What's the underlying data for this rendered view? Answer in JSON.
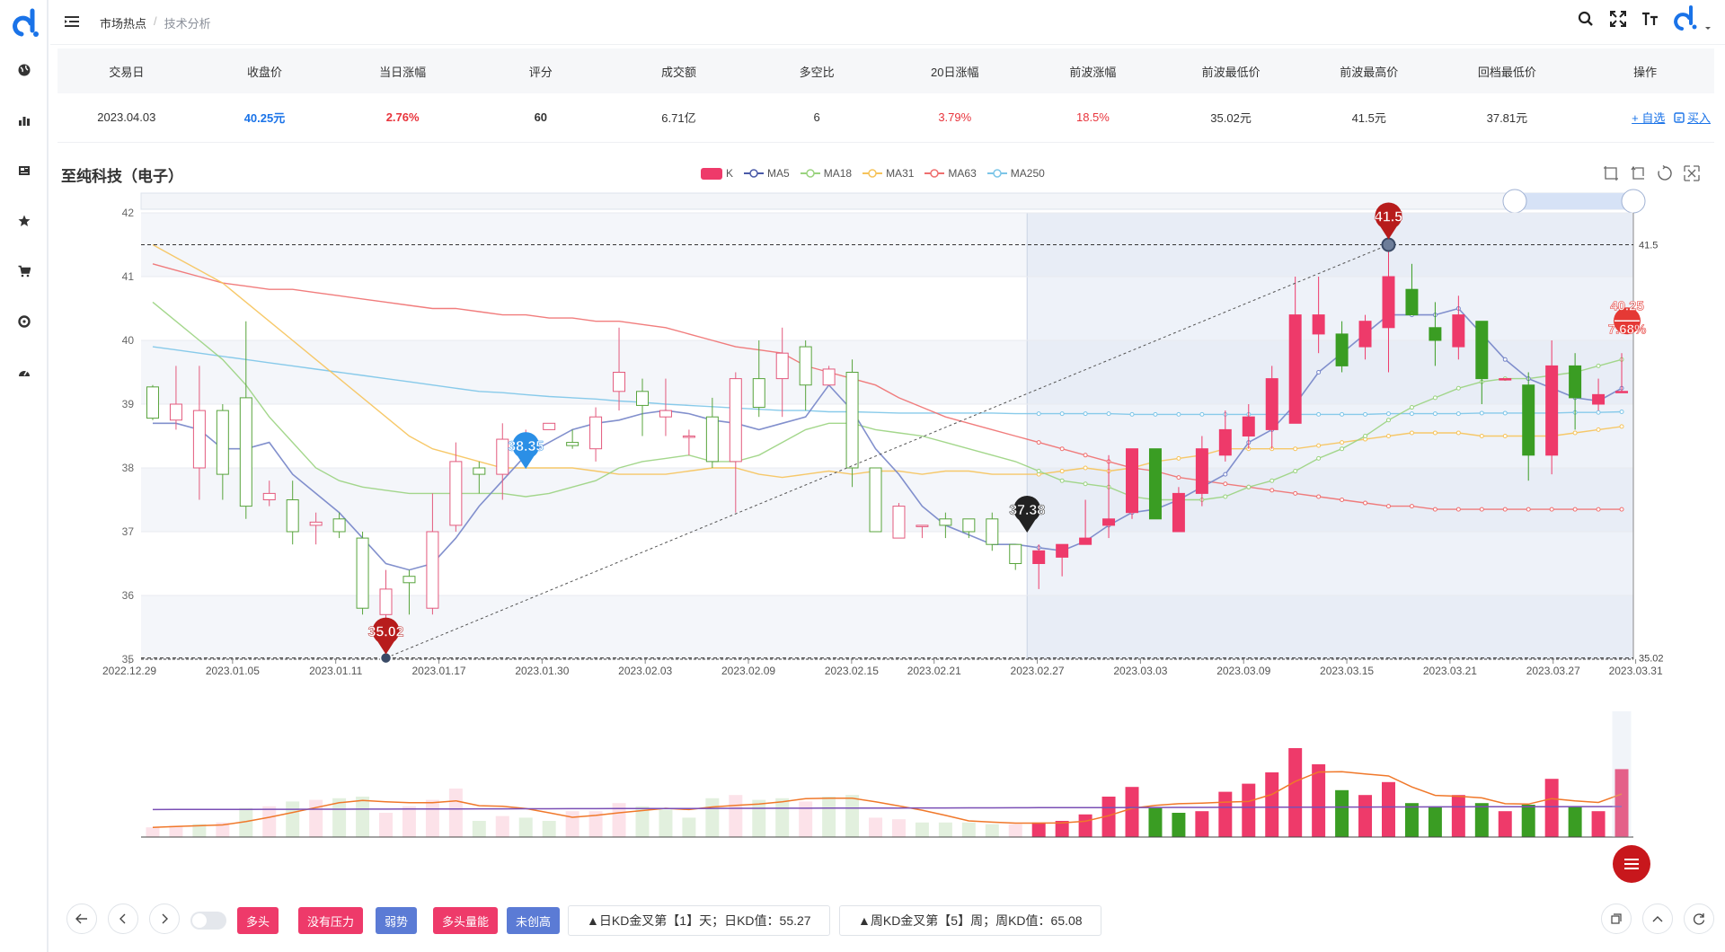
{
  "app": {
    "logo_text": "d",
    "accent": "#1a73e8"
  },
  "sidebar": {
    "items": [
      {
        "icon": "globe-icon"
      },
      {
        "icon": "bar-chart-icon"
      },
      {
        "icon": "newspaper-icon"
      },
      {
        "icon": "star-icon"
      },
      {
        "icon": "cart-icon"
      },
      {
        "icon": "target-icon"
      },
      {
        "icon": "dashboard-icon"
      }
    ]
  },
  "breadcrumb": {
    "parent": "市场热点",
    "separator": "/",
    "current": "技术分析"
  },
  "toolbar": {
    "icons": [
      "search-icon",
      "fullscreen-icon",
      "font-size-icon",
      "user-avatar-icon"
    ]
  },
  "summary": {
    "headers": [
      "交易日",
      "收盘价",
      "当日涨幅",
      "评分",
      "成交额",
      "多空比",
      "20日涨幅",
      "前波涨幅",
      "前波最低价",
      "前波最高价",
      "回档最低价",
      "操作"
    ],
    "row": {
      "date": "2023.04.03",
      "close": "40.25元",
      "change": "2.76%",
      "score": "60",
      "amount": "6.71亿",
      "ratio": "6",
      "change20": "3.79%",
      "wave_change": "18.5%",
      "wave_low": "35.02元",
      "wave_high": "41.5元",
      "pullback_low": "37.81元",
      "op_watch": "+ 自选",
      "op_buy": "买入"
    }
  },
  "chart": {
    "title": "至纯科技（电子）"
  },
  "chart_data": {
    "type": "candlestick",
    "ylim": [
      35,
      42
    ],
    "yticks": [
      "42",
      "41",
      "40",
      "39",
      "38",
      "37",
      "36",
      "35"
    ],
    "xticks": [
      "2022.12.29",
      "2023.01.05",
      "2023.01.11",
      "2023.01.17",
      "2023.01.30",
      "2023.02.03",
      "2023.02.09",
      "2023.02.15",
      "2023.02.21",
      "2023.02.27",
      "2023.03.03",
      "2023.03.09",
      "2023.03.15",
      "2023.03.21",
      "2023.03.27",
      "2023.03.31"
    ],
    "legend": [
      "K",
      "MA5",
      "MA18",
      "MA31",
      "MA63",
      "MA250"
    ],
    "colors": {
      "up": "#ee3a6a",
      "down": "#3a9d23",
      "ma5": "#7484c8",
      "ma18": "#9ad37f",
      "ma31": "#f6c35a",
      "ma63": "#ef6f6f",
      "ma250": "#7cc5e8"
    },
    "markers": {
      "high": "41.5",
      "low": "35.02",
      "mid": "38.35",
      "start": "37.38",
      "last_price": "40.25",
      "last_change": "7.68%"
    },
    "right_labels": [
      "41.5",
      "35.02"
    ],
    "candles": [
      [
        39.27,
        38.78,
        39.3,
        38.75
      ],
      [
        38.75,
        39.0,
        39.6,
        38.6
      ],
      [
        38.0,
        38.9,
        39.6,
        37.5
      ],
      [
        38.9,
        37.9,
        39.0,
        37.5
      ],
      [
        39.1,
        37.4,
        40.3,
        37.2
      ],
      [
        37.5,
        37.6,
        37.8,
        37.4
      ],
      [
        37.5,
        37.0,
        37.8,
        36.8
      ],
      [
        37.1,
        37.15,
        37.3,
        36.8
      ],
      [
        37.2,
        37.0,
        37.3,
        36.9
      ],
      [
        36.9,
        35.8,
        37.0,
        35.7
      ],
      [
        35.7,
        36.1,
        36.4,
        35.5
      ],
      [
        36.3,
        36.2,
        36.4,
        35.7
      ],
      [
        35.8,
        37.0,
        37.6,
        35.7
      ],
      [
        37.1,
        38.1,
        38.4,
        37.0
      ],
      [
        38.0,
        37.9,
        38.1,
        37.6
      ],
      [
        37.9,
        38.45,
        38.7,
        37.5
      ],
      [
        38.35,
        38.4,
        38.6,
        38.1
      ],
      [
        38.6,
        38.7,
        38.7,
        38.6
      ],
      [
        38.4,
        38.35,
        38.6,
        38.3
      ],
      [
        38.3,
        38.8,
        38.95,
        38.1
      ],
      [
        39.2,
        39.5,
        40.2,
        38.9
      ],
      [
        39.2,
        38.98,
        39.4,
        38.5
      ],
      [
        38.8,
        38.9,
        39.4,
        38.5
      ],
      [
        38.5,
        38.5,
        38.6,
        38.2
      ],
      [
        38.8,
        38.1,
        39.1,
        38.0
      ],
      [
        38.1,
        39.4,
        39.5,
        37.3
      ],
      [
        39.4,
        38.95,
        40.0,
        38.8
      ],
      [
        39.4,
        39.8,
        40.2,
        38.8
      ],
      [
        39.9,
        39.3,
        40.0,
        38.9
      ],
      [
        39.3,
        39.55,
        39.6,
        39.3
      ],
      [
        39.5,
        38.0,
        39.7,
        37.7
      ],
      [
        38.0,
        37.0,
        38.0,
        37.0
      ],
      [
        36.9,
        37.4,
        37.45,
        36.9
      ],
      [
        37.1,
        37.1,
        37.1,
        36.9
      ],
      [
        37.2,
        37.1,
        37.3,
        36.9
      ],
      [
        37.2,
        37.0,
        37.2,
        36.9
      ],
      [
        37.2,
        36.8,
        37.3,
        36.7
      ],
      [
        36.8,
        36.5,
        36.8,
        36.4
      ],
      [
        36.5,
        36.7,
        36.8,
        36.1
      ],
      [
        36.6,
        36.8,
        36.8,
        36.3
      ],
      [
        36.8,
        36.9,
        37.5,
        36.8
      ],
      [
        37.1,
        37.2,
        38.2,
        36.9
      ],
      [
        37.3,
        38.3,
        38.3,
        37.2
      ],
      [
        38.3,
        37.2,
        38.3,
        37.2
      ],
      [
        37.0,
        37.6,
        37.7,
        37.0
      ],
      [
        37.6,
        38.3,
        38.5,
        37.4
      ],
      [
        38.2,
        38.6,
        38.9,
        38.1
      ],
      [
        38.5,
        38.8,
        39.0,
        38.3
      ],
      [
        38.6,
        39.4,
        39.6,
        38.3
      ],
      [
        38.7,
        40.4,
        41.0,
        38.7
      ],
      [
        40.1,
        40.4,
        41.0,
        39.8
      ],
      [
        40.1,
        39.6,
        40.3,
        39.5
      ],
      [
        39.9,
        40.3,
        40.4,
        39.7
      ],
      [
        40.2,
        41.0,
        41.5,
        39.5
      ],
      [
        40.8,
        40.4,
        41.2,
        40.4
      ],
      [
        40.2,
        40.0,
        40.6,
        39.6
      ],
      [
        39.9,
        40.4,
        40.7,
        39.7
      ],
      [
        40.3,
        39.4,
        40.3,
        39.0
      ],
      [
        39.4,
        39.4,
        39.4,
        39.4
      ],
      [
        39.3,
        38.2,
        39.5,
        37.8
      ],
      [
        38.2,
        39.6,
        40.0,
        37.9
      ],
      [
        39.6,
        39.1,
        39.8,
        38.6
      ],
      [
        39.0,
        39.15,
        39.4,
        38.9
      ],
      [
        39.2,
        39.2,
        39.8,
        39.2
      ]
    ],
    "volumes": [
      [
        6,
        1
      ],
      [
        7,
        1
      ],
      [
        8,
        0
      ],
      [
        9,
        1
      ],
      [
        18,
        0
      ],
      [
        19,
        1
      ],
      [
        22,
        0
      ],
      [
        23,
        1
      ],
      [
        24,
        0
      ],
      [
        25,
        0
      ],
      [
        15,
        1
      ],
      [
        19,
        1
      ],
      [
        23,
        1
      ],
      [
        30,
        1
      ],
      [
        10,
        0
      ],
      [
        13,
        1
      ],
      [
        12,
        0
      ],
      [
        10,
        0
      ],
      [
        16,
        1
      ],
      [
        16,
        1
      ],
      [
        21,
        1
      ],
      [
        19,
        0
      ],
      [
        17,
        0
      ],
      [
        12,
        0
      ],
      [
        24,
        0
      ],
      [
        26,
        1
      ],
      [
        23,
        0
      ],
      [
        24,
        0
      ],
      [
        22,
        1
      ],
      [
        25,
        0
      ],
      [
        26,
        0
      ],
      [
        12,
        1
      ],
      [
        11,
        1
      ],
      [
        9,
        0
      ],
      [
        9,
        0
      ],
      [
        9,
        0
      ],
      [
        8,
        0
      ],
      [
        8,
        1
      ],
      [
        9,
        1
      ],
      [
        10,
        1
      ],
      [
        14,
        1
      ],
      [
        25,
        1
      ],
      [
        31,
        1
      ],
      [
        18,
        0
      ],
      [
        15,
        0
      ],
      [
        16,
        1
      ],
      [
        28,
        1
      ],
      [
        33,
        1
      ],
      [
        40,
        1
      ],
      [
        55,
        1
      ],
      [
        45,
        1
      ],
      [
        29,
        0
      ],
      [
        26,
        1
      ],
      [
        34,
        1
      ],
      [
        21,
        0
      ],
      [
        19,
        0
      ],
      [
        26,
        1
      ],
      [
        21,
        0
      ],
      [
        16,
        1
      ],
      [
        20,
        0
      ],
      [
        36,
        1
      ],
      [
        19,
        0
      ],
      [
        16,
        1
      ],
      [
        42,
        1
      ]
    ],
    "ma5": [
      38.7,
      38.7,
      38.6,
      38.3,
      38.3,
      38.4,
      37.9,
      37.6,
      37.3,
      36.9,
      36.5,
      36.4,
      36.5,
      36.9,
      37.4,
      37.8,
      38.2,
      38.4,
      38.6,
      38.7,
      38.75,
      38.85,
      38.9,
      38.85,
      38.75,
      38.7,
      38.6,
      38.7,
      38.8,
      39.3,
      38.9,
      38.3,
      37.9,
      37.4,
      37.1,
      36.95,
      36.8,
      36.8,
      36.75,
      36.7,
      36.85,
      37.1,
      37.3,
      37.35,
      37.5,
      37.7,
      37.9,
      38.4,
      38.6,
      39.0,
      39.5,
      39.8,
      40.1,
      40.4,
      40.4,
      40.4,
      40.5,
      40.1,
      39.7,
      39.4,
      39.25,
      39.1,
      39.05,
      39.25
    ],
    "ma18": [
      40.6,
      40.3,
      40.0,
      39.7,
      39.3,
      38.8,
      38.4,
      38.0,
      37.8,
      37.7,
      37.65,
      37.6,
      37.6,
      37.6,
      37.6,
      37.6,
      37.55,
      37.6,
      37.7,
      37.8,
      38.0,
      38.1,
      38.15,
      38.2,
      38.1,
      38.1,
      38.2,
      38.4,
      38.6,
      38.7,
      38.7,
      38.6,
      38.55,
      38.5,
      38.4,
      38.3,
      38.2,
      38.1,
      37.95,
      37.8,
      37.75,
      37.7,
      37.55,
      37.5,
      37.5,
      37.5,
      37.55,
      37.7,
      37.8,
      37.95,
      38.15,
      38.3,
      38.5,
      38.75,
      38.95,
      39.1,
      39.25,
      39.35,
      39.4,
      39.4,
      39.45,
      39.5,
      39.6,
      39.7
    ],
    "ma31": [
      41.5,
      41.3,
      41.1,
      40.9,
      40.6,
      40.3,
      40.0,
      39.7,
      39.4,
      39.1,
      38.8,
      38.5,
      38.3,
      38.2,
      38.1,
      38.0,
      38.0,
      38.0,
      38.0,
      37.95,
      37.9,
      37.9,
      37.9,
      37.95,
      38.0,
      38.0,
      37.9,
      37.85,
      37.9,
      37.95,
      37.9,
      37.95,
      37.95,
      37.9,
      37.95,
      37.95,
      37.9,
      37.9,
      37.9,
      37.95,
      38.0,
      37.95,
      38.0,
      38.1,
      38.15,
      38.2,
      38.3,
      38.3,
      38.3,
      38.3,
      38.35,
      38.4,
      38.45,
      38.5,
      38.55,
      38.55,
      38.55,
      38.5,
      38.5,
      38.5,
      38.5,
      38.55,
      38.6,
      38.65
    ],
    "ma63": [
      41.2,
      41.1,
      41.0,
      40.9,
      40.85,
      40.8,
      40.8,
      40.75,
      40.7,
      40.65,
      40.6,
      40.55,
      40.5,
      40.5,
      40.45,
      40.4,
      40.4,
      40.35,
      40.35,
      40.3,
      40.3,
      40.25,
      40.2,
      40.1,
      40.0,
      39.9,
      39.85,
      39.8,
      39.6,
      39.5,
      39.4,
      39.3,
      39.1,
      38.95,
      38.8,
      38.7,
      38.6,
      38.5,
      38.4,
      38.3,
      38.2,
      38.1,
      38.0,
      37.95,
      37.85,
      37.8,
      37.75,
      37.7,
      37.65,
      37.6,
      37.55,
      37.5,
      37.45,
      37.4,
      37.4,
      37.35,
      37.35,
      37.35,
      37.35,
      37.35,
      37.35,
      37.35,
      37.35,
      37.35
    ],
    "ma250": [
      39.9,
      39.85,
      39.8,
      39.75,
      39.7,
      39.65,
      39.6,
      39.55,
      39.5,
      39.45,
      39.4,
      39.35,
      39.3,
      39.25,
      39.2,
      39.18,
      39.15,
      39.12,
      39.1,
      39.08,
      39.05,
      39.03,
      39.0,
      38.98,
      38.96,
      38.94,
      38.92,
      38.9,
      38.9,
      38.88,
      38.88,
      38.87,
      38.86,
      38.86,
      38.86,
      38.86,
      38.86,
      38.85,
      38.85,
      38.85,
      38.85,
      38.85,
      38.84,
      38.84,
      38.84,
      38.84,
      38.84,
      38.84,
      38.84,
      38.84,
      38.84,
      38.84,
      38.84,
      38.85,
      38.85,
      38.85,
      38.85,
      38.86,
      38.86,
      38.86,
      38.86,
      38.87,
      38.87,
      38.88
    ]
  },
  "bottom": {
    "nav": [
      "arrow-left-icon",
      "chevron-left-icon",
      "chevron-right-icon"
    ],
    "tags": [
      {
        "label": "多头",
        "color": "#ee3a6a"
      },
      {
        "label": "没有压力",
        "color": "#ee3a6a"
      },
      {
        "label": "弱势",
        "color": "#5b7bd5"
      },
      {
        "label": "多头量能",
        "color": "#ee3a6a"
      },
      {
        "label": "未创高",
        "color": "#5b7bd5"
      }
    ],
    "kd_day": "▲日KD金叉第【1】天；日KD值：55.27",
    "kd_week": "▲周KD金叉第【5】周；周KD值：65.08"
  }
}
